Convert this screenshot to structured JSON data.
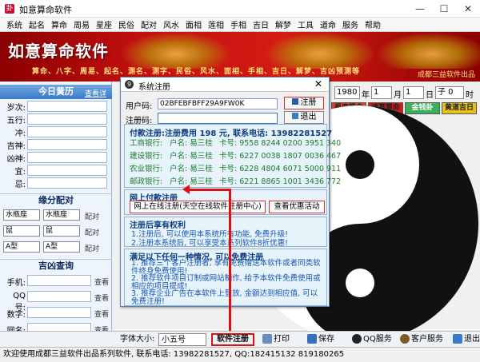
{
  "window": {
    "title": "如意算命软件"
  },
  "menu": [
    "系统",
    "起名",
    "算命",
    "周易",
    "星座",
    "民俗",
    "配对",
    "风水",
    "面相",
    "莲相",
    "手相",
    "吉日",
    "解梦",
    "工具",
    "道命",
    "服务",
    "帮助"
  ],
  "banner": {
    "title": "如意算命软件",
    "slogan": "算命、八字、周易、起名、测名、测字、民俗、风水、面相、手相、吉日、解梦、吉凶预测等",
    "credit": "成都三益软件出品"
  },
  "left": {
    "header": "今日黄历",
    "header_link": "查看详",
    "rows": [
      "岁次:",
      "五行:",
      "冲:",
      "吉神:",
      "凶神:",
      "宜:",
      "忌:"
    ],
    "pair_title": "缘分配对",
    "pair_rows": [
      {
        "a": "水瓶座",
        "b": "水瓶座",
        "btn": "配对"
      },
      {
        "a": "鼠",
        "b": "鼠",
        "btn": "配对"
      },
      {
        "a": "A型",
        "b": "A型",
        "btn": "配对"
      }
    ],
    "luck_title": "吉凶查询",
    "luck_rows": [
      {
        "label": "手机:",
        "btn": "查看"
      },
      {
        "label": "QQ号:",
        "btn": "查看"
      },
      {
        "label": "数字:",
        "btn": "查看"
      },
      {
        "label": "网名:",
        "btn": "查看"
      }
    ]
  },
  "right": {
    "year": "1980",
    "year_unit": "年",
    "month": "1",
    "month_unit": "月",
    "day": "1",
    "day_unit": "日",
    "hour": "子 0",
    "hour_unit": "时",
    "tags": [
      {
        "label": "星座算命",
        "color": "#e23b2b"
      },
      {
        "label": "诸葛算命",
        "color": "#d81818"
      },
      {
        "label": "金钱卦",
        "color": "#3ab05a"
      },
      {
        "label": "黄道吉日",
        "color": "#e8c01a"
      }
    ]
  },
  "dialog": {
    "title": "系统注册",
    "user_code_label": "用户码:",
    "user_code_value": "02BFEBFBFF29A9FW0K",
    "reg_code_label": "注册码:",
    "reg_code_value": "",
    "register_btn": "注册",
    "exit_btn": "退出",
    "pay_title": "付款注册:注册费用 198 元, 联系电话: 13982281527",
    "banks": [
      {
        "bank": "工商银行:",
        "name": "户名: 易三桂",
        "card": "卡号: 9558 8244 0200 3951 340"
      },
      {
        "bank": "建设银行:",
        "name": "户名: 易三桂",
        "card": "卡号: 6227 0038 1807 0036 467"
      },
      {
        "bank": "农业银行:",
        "name": "户名: 易三桂",
        "card": "卡号: 6228 4804 6071 5000 911"
      },
      {
        "bank": "邮政银行:",
        "name": "户名: 易三桂",
        "card": "卡号: 6221 8865 1001 3436 772"
      }
    ],
    "online_title": "网上付款注册",
    "online_btn": "网上在线注册(天空在线软件注册中心)",
    "promo_btn": "查看优惠活动",
    "rights_title": "注册后享有权利",
    "rights": [
      "1.注册后, 可以使用本系统所有功能, 免费升级!",
      "2.注册本系统后, 可以享受本系列软件8折优惠!"
    ],
    "free_title": "满足以下任何一种情况, 可以免费注册",
    "free": [
      "1. 推荐三个客户注册者, 享有免费赠送本软件或者同类软件终身免费使用!",
      "2. 推荐软件项目订制或网站制作, 给予本软件免费使用或相应的项目提成!",
      "3. 推荐企业广告在本软件上登放, 金额达到相应值, 可以免费注册!"
    ]
  },
  "toolbar": {
    "font_label": "字体大小:",
    "font_value": "小五号",
    "register": "软件注册",
    "print": "打印",
    "save": "保存",
    "qq": "QQ服务",
    "service": "客户服务",
    "exit": "退出"
  },
  "status": "欢迎使用成都三益软件出品系列软件, 联系电话: 13982281527, QQ:182415132 819180265"
}
